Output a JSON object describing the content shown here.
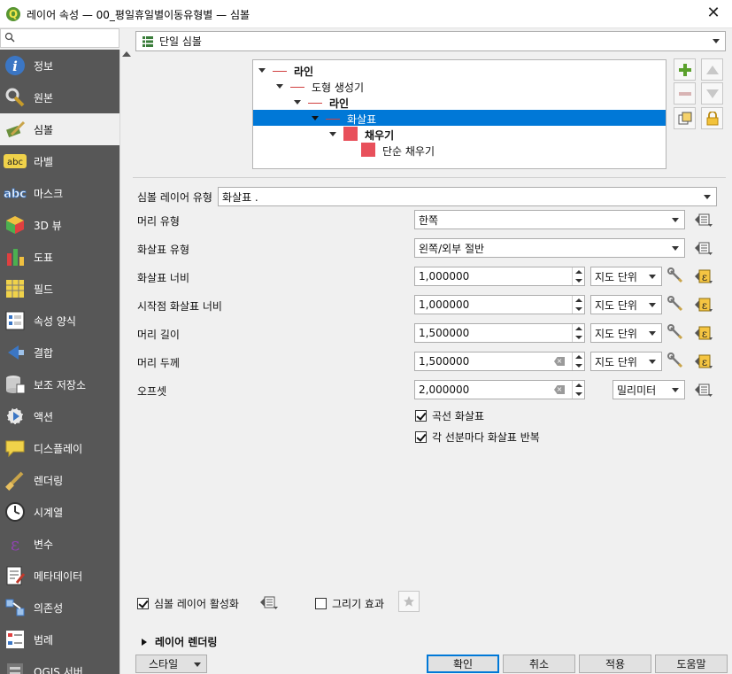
{
  "window": {
    "title": "레이어 속성 — 00_평일휴일별이동유형별 — 심볼",
    "close_label": "✕"
  },
  "search": {
    "placeholder": ""
  },
  "sidebar": {
    "items": [
      {
        "label": "정보",
        "icon": "info-icon"
      },
      {
        "label": "원본",
        "icon": "source-icon"
      },
      {
        "label": "심볼",
        "icon": "symbology-icon",
        "selected": true
      },
      {
        "label": "라벨",
        "icon": "labels-icon"
      },
      {
        "label": "마스크",
        "icon": "masks-icon"
      },
      {
        "label": "3D 뷰",
        "icon": "3d-view-icon"
      },
      {
        "label": "도표",
        "icon": "diagrams-icon"
      },
      {
        "label": "필드",
        "icon": "fields-icon"
      },
      {
        "label": "속성 양식",
        "icon": "attributes-form-icon"
      },
      {
        "label": "결합",
        "icon": "joins-icon"
      },
      {
        "label": "보조 저장소",
        "icon": "auxiliary-storage-icon"
      },
      {
        "label": "액션",
        "icon": "actions-icon"
      },
      {
        "label": "디스플레이",
        "icon": "display-icon"
      },
      {
        "label": "렌더링",
        "icon": "rendering-icon"
      },
      {
        "label": "시계열",
        "icon": "temporal-icon"
      },
      {
        "label": "변수",
        "icon": "variables-icon"
      },
      {
        "label": "메타데이터",
        "icon": "metadata-icon"
      },
      {
        "label": "의존성",
        "icon": "dependencies-icon"
      },
      {
        "label": "범례",
        "icon": "legend-icon"
      },
      {
        "label": "QGIS 서버",
        "icon": "qgis-server-icon"
      }
    ]
  },
  "renderer_select": {
    "value": "단일 심볼"
  },
  "symbol_tree": [
    {
      "label": "라인",
      "bold": true,
      "level": 0,
      "swatch": "line"
    },
    {
      "label": "도형 생성기",
      "bold": false,
      "level": 1,
      "swatch": "line"
    },
    {
      "label": "라인",
      "bold": true,
      "level": 2,
      "swatch": "line"
    },
    {
      "label": "화살표",
      "bold": false,
      "level": 3,
      "swatch": "line",
      "selected": true
    },
    {
      "label": "채우기",
      "bold": true,
      "level": 4,
      "swatch": "fill"
    },
    {
      "label": "단순 채우기",
      "bold": false,
      "level": 5,
      "swatch": "fill"
    }
  ],
  "form": {
    "layer_type_label": "심볼 레이어 유형",
    "layer_type_value": "화살표 .",
    "head_type_label": "머리 유형",
    "head_type_value": "한쪽",
    "arrow_type_label": "화살표 유형",
    "arrow_type_value": "왼쪽/외부 절반",
    "arrow_width_label": "화살표 너비",
    "arrow_width_value": "1,000000",
    "arrow_width_unit": "지도 단위",
    "arrow_start_width_label": "시작점 화살표 너비",
    "arrow_start_width_value": "1,000000",
    "arrow_start_width_unit": "지도 단위",
    "head_length_label": "머리 길이",
    "head_length_value": "1,500000",
    "head_length_unit": "지도 단위",
    "head_thickness_label": "머리 두께",
    "head_thickness_value": "1,500000",
    "head_thickness_unit": "지도 단위",
    "offset_label": "오프셋",
    "offset_value": "2,000000",
    "offset_unit": "밀리미터",
    "curved_label": "곡선 화살표",
    "curved_checked": true,
    "repeat_label": "각 선분마다 화살표 반복",
    "repeat_checked": true
  },
  "bottom": {
    "enable_layer_label": "심볼 레이어 활성화",
    "enable_layer_checked": true,
    "draw_effects_label": "그리기 효과",
    "draw_effects_checked": false,
    "layer_rendering_label": "레이어 렌더링"
  },
  "buttons": {
    "style": "스타일",
    "ok": "확인",
    "cancel": "취소",
    "apply": "적용",
    "help": "도움말"
  },
  "colors": {
    "sidebar_bg": "#575757",
    "selection": "#0078d7",
    "fill_swatch": "#e8505b",
    "line_swatch": "#d04040"
  }
}
